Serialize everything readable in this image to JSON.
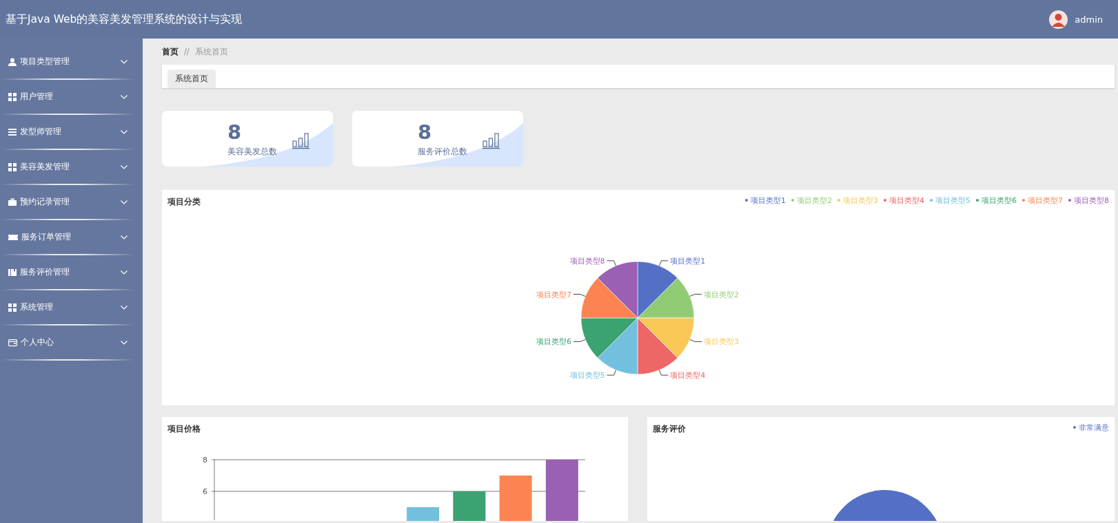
{
  "header": {
    "title": "基于Java Web的美容美发管理系统的设计与实现",
    "user": "admin"
  },
  "sidebar": {
    "items": [
      {
        "label": "项目类型管理"
      },
      {
        "label": "用户管理"
      },
      {
        "label": "发型师管理"
      },
      {
        "label": "美容美发管理"
      },
      {
        "label": "预约记录管理"
      },
      {
        "label": "服务订单管理"
      },
      {
        "label": "服务评价管理"
      },
      {
        "label": "系统管理"
      },
      {
        "label": "个人中心"
      }
    ]
  },
  "breadcrumb": {
    "items": [
      "首页",
      "系统首页"
    ],
    "separator": "//"
  },
  "tabs": [
    {
      "label": "系统首页",
      "selected": true
    }
  ],
  "stats": [
    {
      "value": "8",
      "label": "美容美发总数"
    },
    {
      "value": "8",
      "label": "服务评价总数"
    }
  ],
  "category_panel": {
    "title": "项目分类",
    "legend": [
      {
        "label": "项目类型1",
        "color": "#5470c6"
      },
      {
        "label": "项目类型2",
        "color": "#91cc75"
      },
      {
        "label": "项目类型3",
        "color": "#fac858"
      },
      {
        "label": "项目类型4",
        "color": "#ee6666"
      },
      {
        "label": "项目类型5",
        "color": "#73c0de"
      },
      {
        "label": "项目类型6",
        "color": "#3ba272"
      },
      {
        "label": "项目类型7",
        "color": "#fc8452"
      },
      {
        "label": "项目类型8",
        "color": "#9a60b4"
      }
    ],
    "chart_data": {
      "type": "pie",
      "categories": [
        "项目类型1",
        "项目类型2",
        "项目类型3",
        "项目类型4",
        "项目类型5",
        "项目类型6",
        "项目类型7",
        "项目类型8"
      ],
      "values": [
        1,
        1,
        1,
        1,
        1,
        1,
        1,
        1
      ]
    }
  },
  "price_panel": {
    "title": "项目价格",
    "chart_data": {
      "type": "bar",
      "values": [
        null,
        null,
        null,
        null,
        5,
        6,
        7,
        8
      ],
      "ylim": [
        4,
        8
      ],
      "yticks": [
        6,
        8
      ]
    }
  },
  "rating_panel": {
    "title": "服务评价",
    "legend": [
      {
        "label": "非常满意",
        "color": "#5470c6"
      }
    ]
  }
}
